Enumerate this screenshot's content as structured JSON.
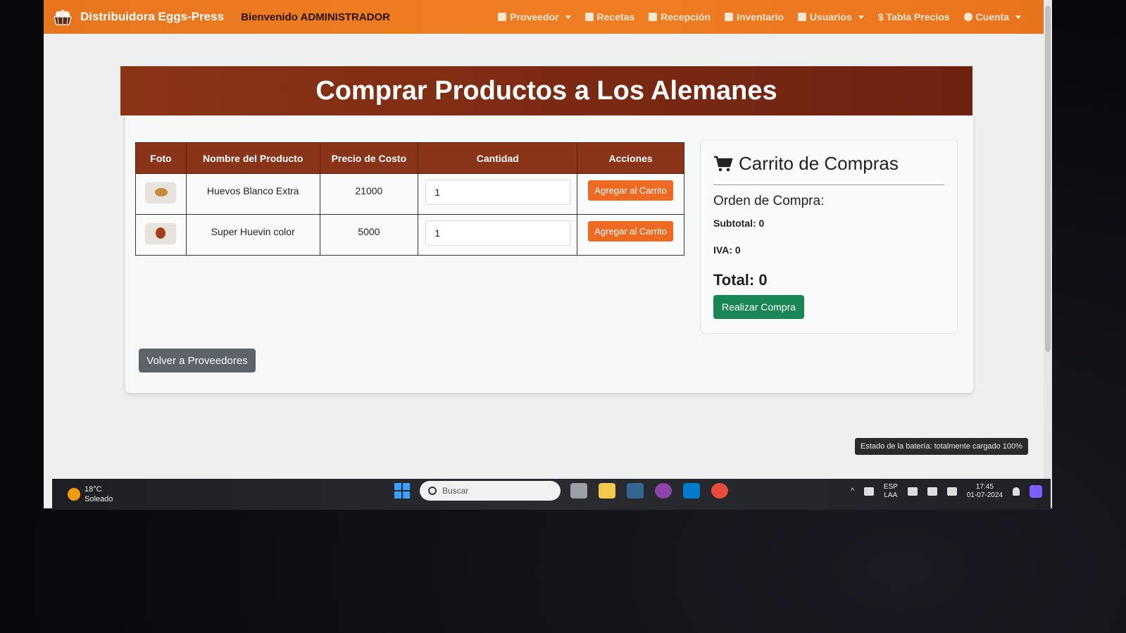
{
  "navbar": {
    "brand": "Distribuidora Eggs-Press",
    "welcome": "Bienvenido ADMINISTRADOR",
    "items": [
      {
        "label": "Proveedor",
        "icon": "clipboard-icon",
        "dropdown": true
      },
      {
        "label": "Recetas",
        "icon": "book-icon",
        "dropdown": false
      },
      {
        "label": "Recepción",
        "icon": "inbox-icon",
        "dropdown": false
      },
      {
        "label": "Inventario",
        "icon": "warehouse-icon",
        "dropdown": false
      },
      {
        "label": "Usuarios",
        "icon": "users-icon",
        "dropdown": true
      },
      {
        "label": "$ Tabla Precios",
        "icon": "",
        "dropdown": false
      },
      {
        "label": "Cuenta",
        "icon": "user-circle-icon",
        "dropdown": true
      }
    ]
  },
  "page": {
    "title": "Comprar Productos a Los Alemanes"
  },
  "table": {
    "headers": [
      "Foto",
      "Nombre del Producto",
      "Precio de Costo",
      "Cantidad",
      "Acciones"
    ],
    "rows": [
      {
        "name": "Huevos Blanco Extra",
        "price": "21000",
        "quantity": "1",
        "action": "Agregar al Carrito"
      },
      {
        "name": "Super Huevin color",
        "price": "5000",
        "quantity": "1",
        "action": "Agregar al Carrito"
      }
    ]
  },
  "back_button": "Volver a Proveedores",
  "cart": {
    "title": "Carrito de Compras",
    "order_label": "Orden de Compra:",
    "subtotal": "Subtotal: 0",
    "iva": "IVA: 0",
    "total": "Total: 0",
    "buy_button": "Realizar Compra"
  },
  "tooltip": "Estado de la batería: totalmente cargado 100%",
  "taskbar": {
    "temperature": "18°C",
    "weather": "Soleado",
    "search_placeholder": "Buscar",
    "lang_top": "ESP",
    "lang_bottom": "LAA",
    "time": "17:45",
    "date": "01-07-2024"
  },
  "colors": {
    "navbar": "#ef7e22",
    "banner": "#7c2b13",
    "table_header": "#8a3419",
    "add_button": "#ee6a22",
    "buy_button": "#198754",
    "back_button": "#5c636a"
  }
}
